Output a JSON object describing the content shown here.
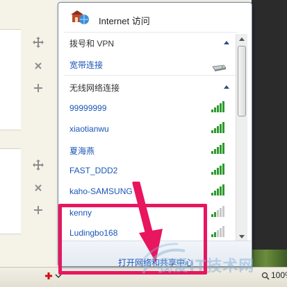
{
  "flyout": {
    "header": {
      "title": "Internet 访问",
      "icon": "internet-access-icon"
    },
    "dialup": {
      "title": "拨号和 VPN",
      "items": [
        {
          "label": "宽带连接",
          "icon": "modem-icon"
        }
      ]
    },
    "wireless": {
      "title": "无线网络连接",
      "networks": [
        {
          "label": "99999999",
          "signal_bars": 5
        },
        {
          "label": "xiaotianwu",
          "signal_bars": 5
        },
        {
          "label": "夏海燕",
          "signal_bars": 5
        },
        {
          "label": "FAST_DDD2",
          "signal_bars": 5
        },
        {
          "label": "kaho-SAMSUNG",
          "signal_bars": 5
        },
        {
          "label": "kenny",
          "signal_bars": 2
        },
        {
          "label": "Ludingbo168",
          "signal_bars": 2
        }
      ]
    },
    "footer": {
      "link": "打开网络和共享中心"
    }
  },
  "background": {
    "tools": [
      "move-icon",
      "close-icon",
      "add-icon",
      "move-icon",
      "close-icon",
      "add-icon"
    ]
  },
  "statusbar": {
    "zoom": "100%"
  },
  "overlay": {
    "highlight_color": "#e8155f",
    "watermark": "我爱IT技术网"
  },
  "colors": {
    "link": "#1a55b7",
    "signal": "#2e9a2e",
    "highlight": "#e8155f"
  }
}
